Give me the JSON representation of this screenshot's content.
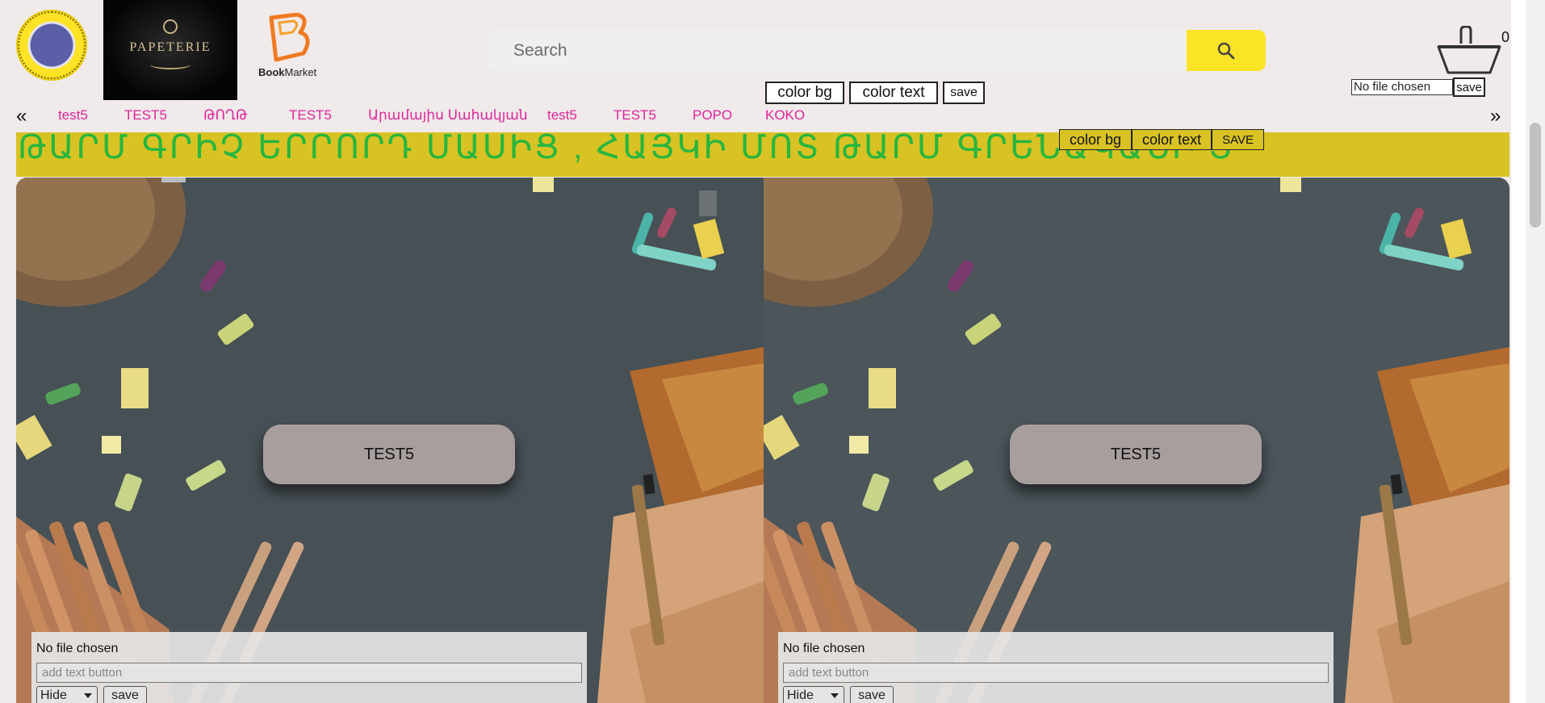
{
  "header": {
    "search": {
      "placeholder": "Search"
    },
    "style_controls": {
      "color_bg": "color bg",
      "color_text": "color text",
      "save": "save"
    },
    "cart": {
      "count": "0"
    },
    "upload": {
      "status": "No file chosen",
      "save": "save"
    },
    "logos": {
      "papeterie": "PAPETERIE",
      "bookmarket_bold": "Book",
      "bookmarket_rest": "Market"
    }
  },
  "nav": {
    "prev": "«",
    "next": "»",
    "items": [
      "test5",
      "TEST5",
      "ԹՈՂԹ",
      "TEST5",
      "Արամայիս Սահակյան",
      "test5",
      "TEST5",
      "POPO",
      "KOKO"
    ]
  },
  "banner": {
    "text": "ԹԱՐՄ ԳՐԻՉ ԵՐՐՈՐԴ ՄԱՍԻՑ , ՀԱՅԿԻ ՄՈՏ ԹԱՐՄ ԳՐԵՆԱԿԱՆԻ Տ",
    "color_bg": "color bg",
    "color_text": "color text",
    "save": "SAVE"
  },
  "slides": [
    {
      "button": "TEST5",
      "file_status": "No file chosen",
      "text_placeholder": "add text button",
      "visibility": "Hide",
      "save": "save"
    },
    {
      "button": "TEST5",
      "file_status": "No file chosen",
      "text_placeholder": "add text button",
      "visibility": "Hide",
      "save": "save"
    }
  ],
  "colors": {
    "accent_yellow": "#fbe326",
    "nav_pink": "#e0249a",
    "banner_bg": "#d9c223",
    "banner_text": "#27b63e"
  }
}
